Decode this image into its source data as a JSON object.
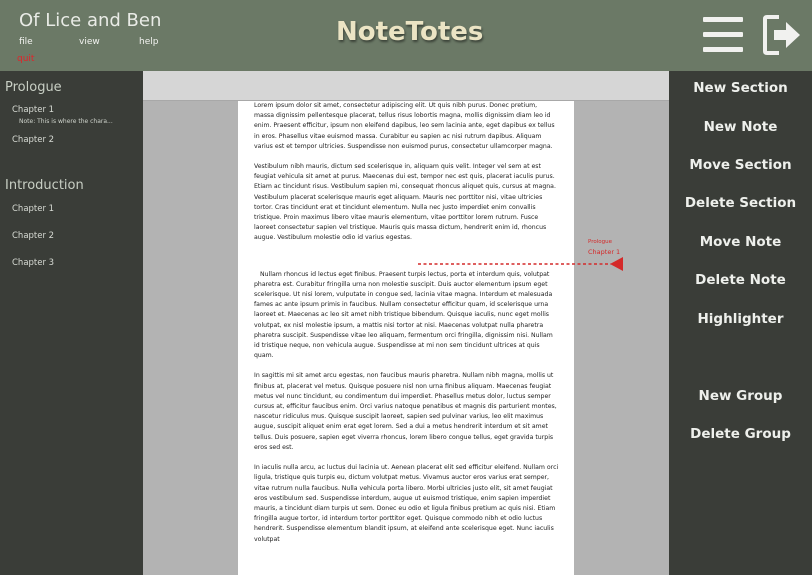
{
  "header": {
    "doc_title": "Of Lice and Ben",
    "menu": {
      "file": "file",
      "view": "view",
      "help": "help",
      "quit": "quit"
    },
    "app_title": "NoteTotes"
  },
  "outline": {
    "sections": [
      {
        "title": "Prologue",
        "chapters": [
          "Chapter 1",
          "Chapter 2"
        ],
        "note": "Note: This is where the chara..."
      },
      {
        "title": "Introduction",
        "chapters": [
          "Chapter 1",
          "Chapter 2",
          "Chapter 3"
        ]
      }
    ]
  },
  "document": {
    "paragraphs": [
      "Lorem ipsum dolor sit amet, consectetur adipiscing elit. Ut quis nibh purus. Donec pretium, massa dignissim pellentesque placerat, tellus risus lobortis magna, mollis dignissim diam leo id enim. Praesent efficitur, ipsum non eleifend dapibus, leo sem lacinia ante, eget dapibus ex tellus in eros. Phasellus vitae euismod massa. Curabitur eu sapien ac nisi rutrum dapibus. Aliquam varius est et tempor ultricies. Suspendisse non euismod purus, consectetur ullamcorper magna.",
      "Vestibulum nibh mauris, dictum sed scelerisque in, aliquam quis velit. Integer vel sem at est feugiat vehicula sit amet at purus. Maecenas dui est, tempor nec est quis, placerat iaculis purus. Etiam ac tincidunt risus. Vestibulum sapien mi, consequat rhoncus aliquet quis, cursus at magna. Vestibulum placerat scelerisque mauris eget aliquam. Mauris nec porttitor nisi, vitae ultricies tortor. Cras tincidunt erat et tincidunt elementum. Nulla nec justo imperdiet enim convallis tristique. Proin maximus libero vitae mauris elementum, vitae porttitor lorem rutrum. Fusce laoreet consectetur sapien vel tristique. Mauris quis massa dictum, hendrerit enim id, rhoncus augue. Vestibulum molestie odio id varius egestas.",
      "Nullam rhoncus id lectus eget finibus. Praesent turpis lectus, porta et interdum quis, volutpat pharetra est. Curabitur fringilla urna non molestie suscipit. Duis auctor elementum ipsum eget scelerisque. Ut nisi lorem, vulputate in congue sed, lacinia vitae magna. Interdum et malesuada fames ac ante ipsum primis in faucibus. Nullam consectetur efficitur quam, id scelerisque urna laoreet et. Maecenas ac leo sit amet nibh tristique bibendum. Quisque iaculis, nunc eget mollis volutpat, ex nisl molestie ipsum, a mattis nisi tortor at nisi. Maecenas volutpat nulla pharetra pharetra suscipit. Suspendisse vitae leo aliquam, fermentum orci fringilla, dignissim nisi. Nullam id tristique neque, non vehicula augue. Suspendisse at mi non sem tincidunt ultrices at quis quam.",
      "In sagittis mi sit amet arcu egestas, non faucibus mauris pharetra. Nullam nibh magna, mollis ut finibus at, placerat vel metus. Quisque posuere nisl non urna finibus aliquam. Maecenas feugiat metus vel nunc tincidunt, eu condimentum dui imperdiet. Phasellus metus dolor, luctus semper cursus at, efficitur faucibus enim. Orci varius natoque penatibus et magnis dis parturient montes, nascetur ridiculus mus. Quisque suscipit laoreet, sapien sed pulvinar varius, leo elit maximus augue, suscipit aliquet enim erat eget lorem. Sed a dui a metus hendrerit interdum et sit amet tellus. Duis posuere, sapien eget viverra rhoncus, lorem libero congue tellus, eget gravida turpis eros sed est.",
      "In iaculis nulla arcu, ac luctus dui lacinia ut. Aenean placerat elit sed efficitur eleifend. Nullam orci ligula, tristique quis turpis eu, dictum volutpat metus. Vivamus auctor eros varius erat semper, vitae rutrum nulla faucibus. Nulla vehicula porta libero. Morbi ultricies justo elit, sit amet feugiat eros vestibulum sed. Suspendisse interdum, augue ut euismod tristique, enim sapien imperdiet mauris, a tincidunt diam turpis ut sem. Donec eu odio et ligula finibus pretium ac quis nisi. Etiam fringilla augue tortor, id interdum tortor porttitor eget. Quisque commodo nibh et odio luctus hendrerit. Suspendisse elementum blandit ipsum, at eleifend ante scelerisque eget. Nunc iaculis volutpat"
    ]
  },
  "annotation": {
    "section": "Prologue",
    "chapter": "Chapter 1",
    "color": "#d42a2a"
  },
  "actions": {
    "new_section": "New Section",
    "new_note": "New Note",
    "move_section": "Move Section",
    "delete_section": "Delete Section",
    "move_note": "Move Note",
    "delete_note": "Delete Note",
    "highlighter": "Highlighter",
    "new_group": "New Group",
    "delete_group": "Delete Group"
  },
  "icons": {
    "menu": "hamburger-menu-icon",
    "exit": "exit-icon"
  },
  "colors": {
    "header": "#6b7966",
    "sidebar": "#3a3d38",
    "accent": "#d42a2a",
    "title": "#ebe4c4"
  }
}
